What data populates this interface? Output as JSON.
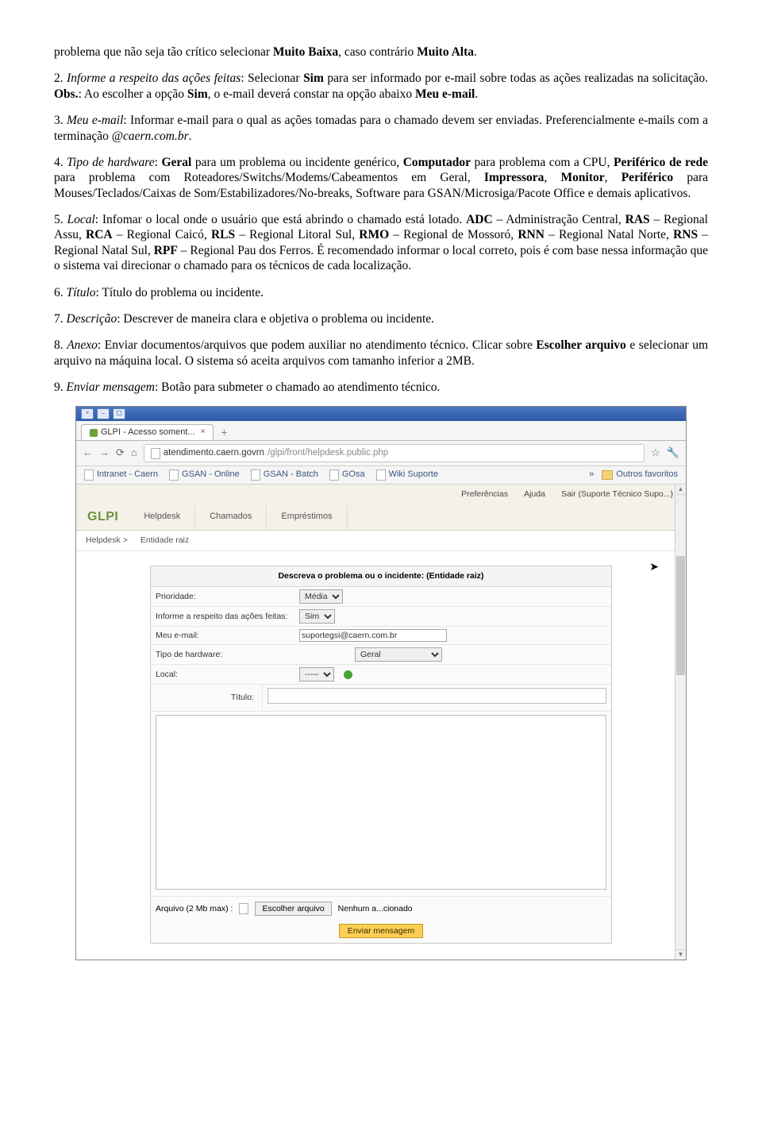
{
  "p1_a": "problema que não seja tão crítico selecionar ",
  "p1_b": "Muito Baixa",
  "p1_c": ", caso contrário ",
  "p1_d": "Muito Alta",
  "p1_e": ".",
  "p2_a": "2. ",
  "p2_b": "Informe a respeito das ações feitas",
  "p2_c": ": Selecionar ",
  "p2_d": "Sim",
  "p2_e": " para ser informado por e-mail sobre todas as ações realizadas na solicitação. ",
  "p2_f": "Obs.",
  "p2_g": ": Ao escolher a opção ",
  "p2_h": "Sim",
  "p2_i": ", o e-mail deverá constar na opção abaixo ",
  "p2_j": "Meu e-mail",
  "p2_k": ".",
  "p3_a": "3. ",
  "p3_b": "Meu e-mail",
  "p3_c": ": Informar e-mail para o qual as ações tomadas para o chamado devem ser enviadas. Preferencialmente e-mails com a terminação ",
  "p3_d": "@caern.com.br",
  "p3_e": ".",
  "p4_a": "4. ",
  "p4_b": "Tipo de hardware",
  "p4_c": ": ",
  "p4_d": "Geral",
  "p4_e": " para um problema ou incidente genérico, ",
  "p4_f": "Computador",
  "p4_g": " para problema com a CPU, ",
  "p4_h": "Periférico de rede",
  "p4_i": " para problema com Roteadores/Switchs/Modems/Cabeamentos em Geral, ",
  "p4_j": "Impressora",
  "p4_k": ", ",
  "p4_l": "Monitor",
  "p4_m": ", ",
  "p4_n": "Periférico",
  "p4_o": " para Mouses/Teclados/Caixas de Som/Estabilizadores/No-breaks, Software para GSAN/Microsiga/Pacote Office e demais aplicativos.",
  "p5_a": "5. ",
  "p5_b": "Local",
  "p5_c": ": Infomar o local onde o usuário que está abrindo o chamado está lotado. ",
  "p5_d": "ADC",
  "p5_e": " – Administração Central, ",
  "p5_f": "RAS",
  "p5_g": " – Regional Assu, ",
  "p5_h": "RCA",
  "p5_i": " – Regional Caicó, ",
  "p5_j": "RLS",
  "p5_k": " – Regional Litoral Sul, ",
  "p5_l": "RMO",
  "p5_m": " – Regional de Mossoró, ",
  "p5_n": "RNN",
  "p5_o": " – Regional Natal Norte, ",
  "p5_p": "RNS",
  "p5_q": " – Regional Natal Sul, ",
  "p5_r": "RPF",
  "p5_s": " – Regional Pau dos Ferros. É recomendado informar o local correto, pois é com base nessa informação que o sistema vai direcionar o chamado para os técnicos de cada localização.",
  "p6_a": "6. ",
  "p6_b": "Título",
  "p6_c": ": Título do problema ou incidente.",
  "p7_a": "7. ",
  "p7_b": "Descrição",
  "p7_c": ": Descrever de maneira clara e objetiva o problema ou incidente.",
  "p8_a": "8. ",
  "p8_b": "Anexo",
  "p8_c": ": Enviar documentos/arquivos que podem auxiliar no atendimento técnico. Clicar sobre ",
  "p8_d": "Escolher arquivo",
  "p8_e": " e selecionar um arquivo na máquina local. O sistema só aceita arquivos com tamanho inferior a 2MB.",
  "p9_a": "9. ",
  "p9_b": "Enviar mensagem",
  "p9_c": ": Botão para submeter o chamado ao atendimento técnico.",
  "shot": {
    "tab_title": "GLPI - Acesso soment...",
    "url_host": "atendimento.caern.govrn",
    "url_path": "/glpi/front/helpdesk.public.php",
    "bookmarks": {
      "b1": "Intranet - Caern",
      "b2": "GSAN - Online",
      "b3": "GSAN - Batch",
      "b4": "GOsa",
      "b5": "Wiki Suporte",
      "more": "»",
      "folder": "Outros favoritos"
    },
    "logo": "GLPI",
    "menu": {
      "m1": "Helpdesk",
      "m2": "Chamados",
      "m3": "Empréstimos"
    },
    "top_links": {
      "l1": "Preferências",
      "l2": "Ajuda",
      "l3": "Sair (Suporte Técnico Supo...)"
    },
    "breadcrumb": {
      "a": "Helpdesk >",
      "b": "Entidade raiz"
    },
    "form": {
      "title": "Descreva o problema ou o incidente:  (Entidade raiz)",
      "priority_label": "Prioridade:",
      "priority_value": "Média",
      "inform_label": "Informe a respeito das ações feitas:",
      "inform_value": "Sim",
      "email_label": "Meu e-mail:",
      "email_value": "suportegsi@caern.com.br",
      "hw_label": "Tipo de hardware:",
      "hw_value": "Geral",
      "local_label": "Local:",
      "local_value": "-----",
      "titulo_label": "Título:",
      "attach_label": "Arquivo (2 Mb max) :",
      "attach_btn": "Escolher arquivo",
      "attach_state": "Nenhum a...cionado",
      "send": "Enviar mensagem"
    }
  }
}
